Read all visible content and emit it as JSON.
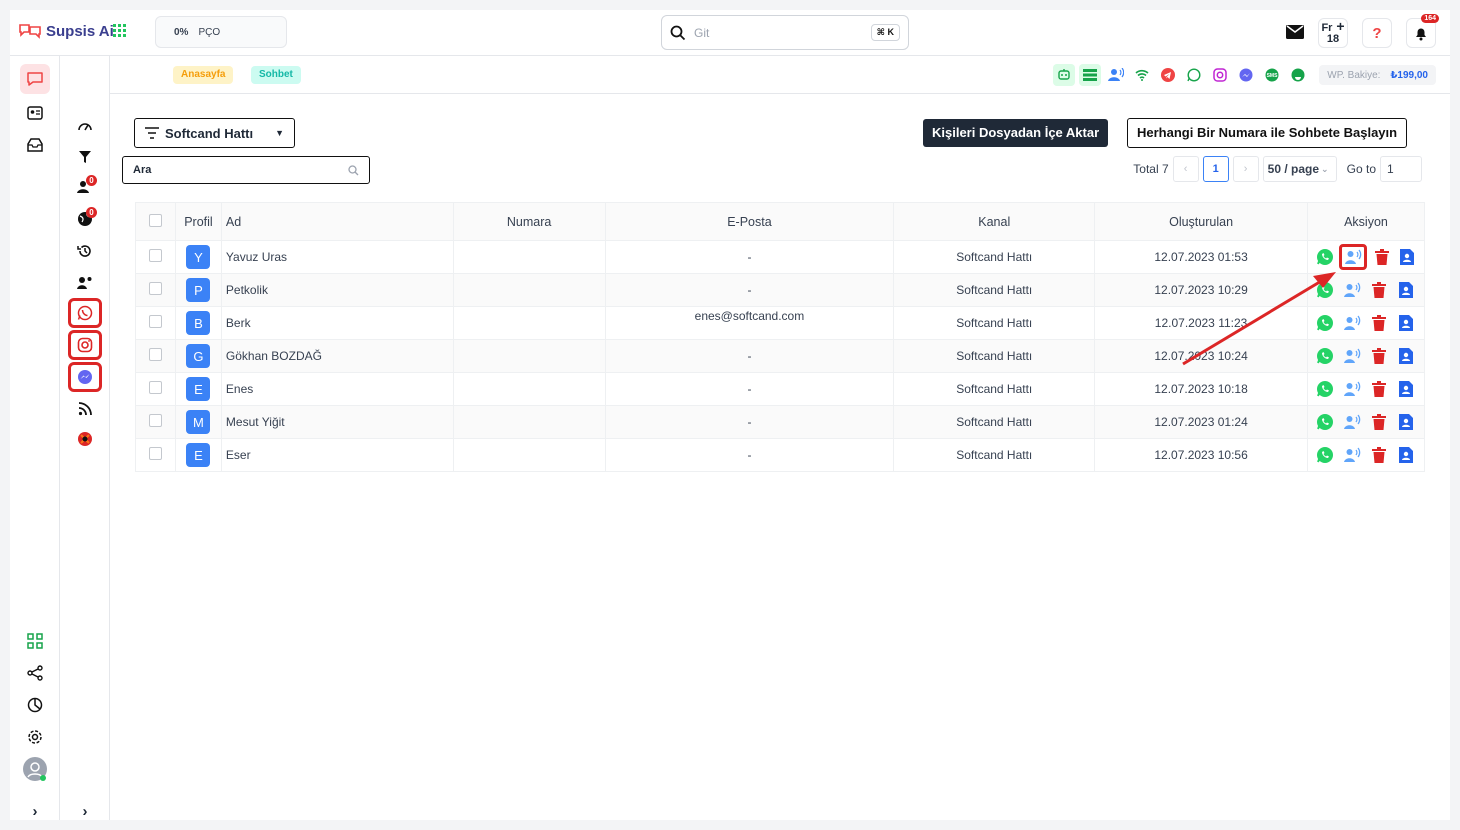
{
  "app": {
    "name": "Supsis Ai"
  },
  "org": {
    "percent": "0%",
    "code": "PÇO"
  },
  "top_search": {
    "placeholder": "Git",
    "shortcut": "⌘ K"
  },
  "top_right": {
    "fr_label": "Fr",
    "fr_number": "18",
    "notifications": "164"
  },
  "breadcrumbs": [
    "Anasayfa",
    "Sohbet"
  ],
  "balance": {
    "label": "WP. Bakiye:",
    "value": "₺199,00"
  },
  "sidebar_badges": {
    "visitors": "0",
    "global": "0"
  },
  "toolbar": {
    "line_select": "Softcand Hattı",
    "import_button": "Kişileri Dosyadan İçe Aktar",
    "start_chat_button": "Herhangi Bir Numara ile Sohbete Başlayın",
    "search_placeholder": "Ara"
  },
  "pagination": {
    "total": "Total 7",
    "current": "1",
    "page_size": "50 / page",
    "goto_label": "Go to",
    "goto_value": "1"
  },
  "table": {
    "columns": [
      "Profil",
      "Ad",
      "Numara",
      "E-Posta",
      "Kanal",
      "Oluşturulan",
      "Aksiyon"
    ],
    "rows": [
      {
        "initial": "Y",
        "name": "Yavuz Uras",
        "number": "",
        "email": "-",
        "channel": "Softcand Hattı",
        "created": "12.07.2023 01:53"
      },
      {
        "initial": "P",
        "name": "Petkolik",
        "number": "",
        "email": "-",
        "channel": "Softcand Hattı",
        "created": "12.07.2023 10:29"
      },
      {
        "initial": "B",
        "name": "Berk",
        "number": "",
        "email": "enes@softcand.com",
        "channel": "Softcand Hattı",
        "created": "12.07.2023 11:23"
      },
      {
        "initial": "G",
        "name": "Gökhan BOZDAĞ",
        "number": "",
        "email": "-",
        "channel": "Softcand Hattı",
        "created": "12.07.2023 10:24"
      },
      {
        "initial": "E",
        "name": "Enes",
        "number": "",
        "email": "-",
        "channel": "Softcand Hattı",
        "created": "12.07.2023 10:18"
      },
      {
        "initial": "M",
        "name": "Mesut Yiğit",
        "number": "",
        "email": "-",
        "channel": "Softcand Hattı",
        "created": "12.07.2023 01:24"
      },
      {
        "initial": "E",
        "name": "Eser",
        "number": "",
        "email": "-",
        "channel": "Softcand Hattı",
        "created": "12.07.2023 10:56"
      }
    ]
  },
  "colors": {
    "brand": "#3b3f8f",
    "highlight": "#dc2626",
    "accent": "#3b82f6",
    "whatsapp": "#25d366"
  }
}
